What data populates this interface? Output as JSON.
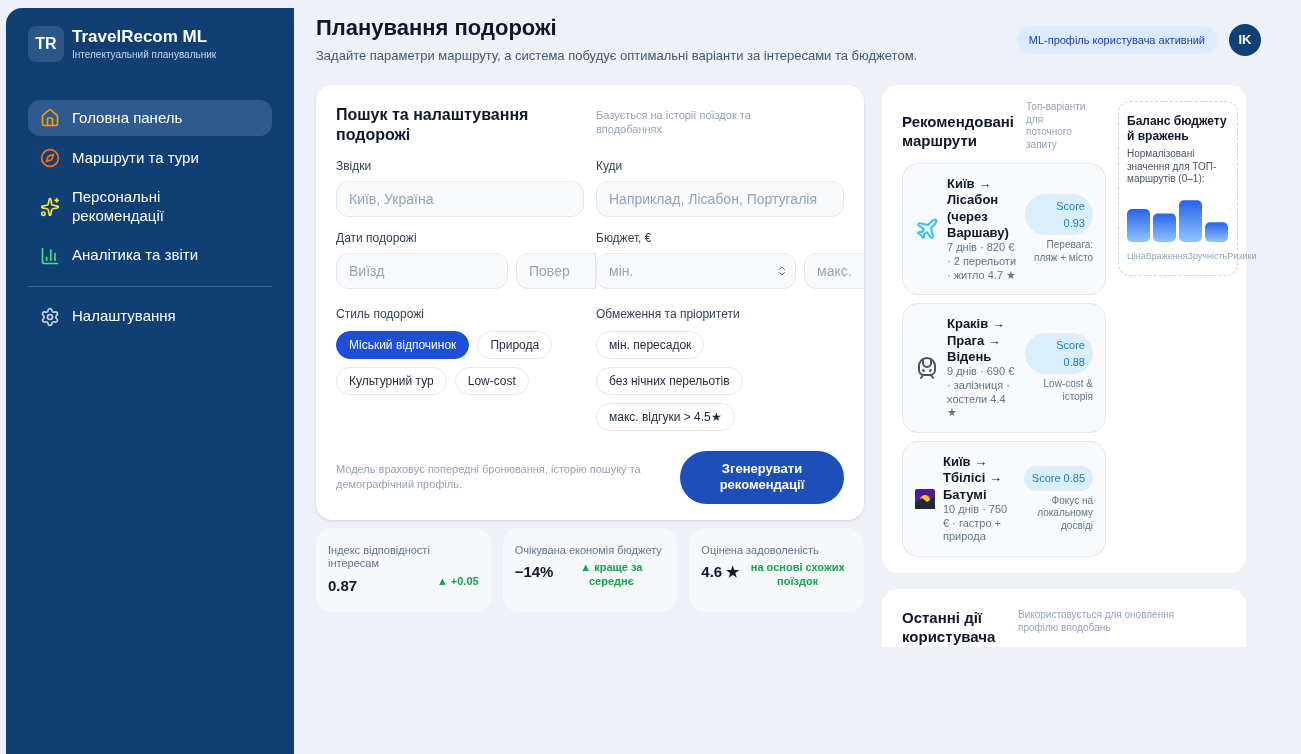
{
  "brand": {
    "logo": "TR",
    "name": "TravelRecom ML",
    "tagline": "Інтелектуальний планувальник"
  },
  "sidebar": {
    "items": [
      {
        "label": "Головна панель",
        "kind": "house",
        "selected": true
      },
      {
        "label": "Маршрути та тури",
        "kind": "compass",
        "selected": false
      },
      {
        "label": "Персональні рекомендації",
        "kind": "sparkles",
        "selected": false
      },
      {
        "label": "Аналітика та звіти",
        "kind": "chart",
        "selected": false
      }
    ],
    "bottom_items": [
      {
        "label": "Налаштування",
        "kind": "gear",
        "selected": false
      }
    ]
  },
  "header": {
    "title": "Планування подорожі",
    "subtitle": "Задайте параметри маршруту, а система побудує оптимальні варіанти за інтересами та бюджетом.",
    "badge": "ML-профіль користувача активний",
    "avatar": "IK"
  },
  "search_card": {
    "title": "Пошук та налаштування подорожі",
    "note": "Базується на історії поїздок та вподобаннях",
    "from": {
      "label": "Звідки",
      "placeholder": "Київ, Україна"
    },
    "to": {
      "label": "Куди",
      "placeholder": "Наприклад, Лісабон, Португалія"
    },
    "dates": {
      "label": "Дати подорожі",
      "start_placeholder": "Виїзд",
      "end_placeholder": "Повер"
    },
    "budget": {
      "label": "Бюджет, €",
      "min_placeholder": "мін.",
      "max_placeholder": "макс."
    },
    "styles": {
      "label": "Стиль подорожі",
      "chips": [
        {
          "label": "Міський відпочинок",
          "selected": true
        },
        {
          "label": "Природа",
          "selected": false
        },
        {
          "label": "Культурний тур",
          "selected": false
        },
        {
          "label": "Low-cost",
          "selected": false
        }
      ]
    },
    "constraints": {
      "label": "Обмеження та пріоритети",
      "chips": [
        {
          "label": "мін. пересадок",
          "selected": false
        },
        {
          "label": "без нічних перельотів",
          "selected": false
        },
        {
          "label": "макс. відгуки > 4.5★",
          "selected": false
        }
      ]
    },
    "footnote": "Модель враховує попередні бронювання, історію пошуку та демографічний профіль.",
    "button": "Згенерувати рекомендації"
  },
  "metrics": [
    {
      "label": "Індекс відповідності інтересам",
      "value": "0.87",
      "delta": "▲ +0.05"
    },
    {
      "label": "Очікувана економія бюджету",
      "value": "−14%",
      "delta": "▲ краще за середнє"
    },
    {
      "label": "Оцінена задоволеність",
      "value": "4.6 ★",
      "delta": "на основі схожих поїздок"
    }
  ],
  "recommendations": {
    "title": "Рекомендовані маршрути",
    "note": "Топ-варіанти для поточного запиту",
    "routes": [
      {
        "kind": "plane",
        "name": "Київ → Лісабон (через Варшаву)",
        "details": "7 днів · 820 € · 2 перельоти · житло 4.7 ★",
        "score": "Score 0.93",
        "tag": "Перевага: пляж + місто"
      },
      {
        "kind": "train",
        "name": "Краків → Прага → Відень",
        "details": "9 днів · 690 € · залізниця · хостели 4.4 ★",
        "score": "Score 0.88",
        "tag": "Low-cost & історія"
      },
      {
        "kind": "sunset",
        "name": "Київ → Тбілісі → Батумі",
        "details": "10 днів · 750 € · гастро + природа",
        "score": "Score 0.85",
        "tag": "Фокус на локальному досвіді"
      }
    ]
  },
  "balance": {
    "title": "Баланс бюджету й вражень",
    "description": "Нормалізовані значення для ТОП-маршрутів (0–1):",
    "bar_labels": [
      "Ціна",
      "Враження",
      "Зручність",
      "Ризики"
    ]
  },
  "recent_activity": {
    "title": "Останні дії користувача",
    "note": "Використовується для оновлення профілю вподобань"
  }
}
